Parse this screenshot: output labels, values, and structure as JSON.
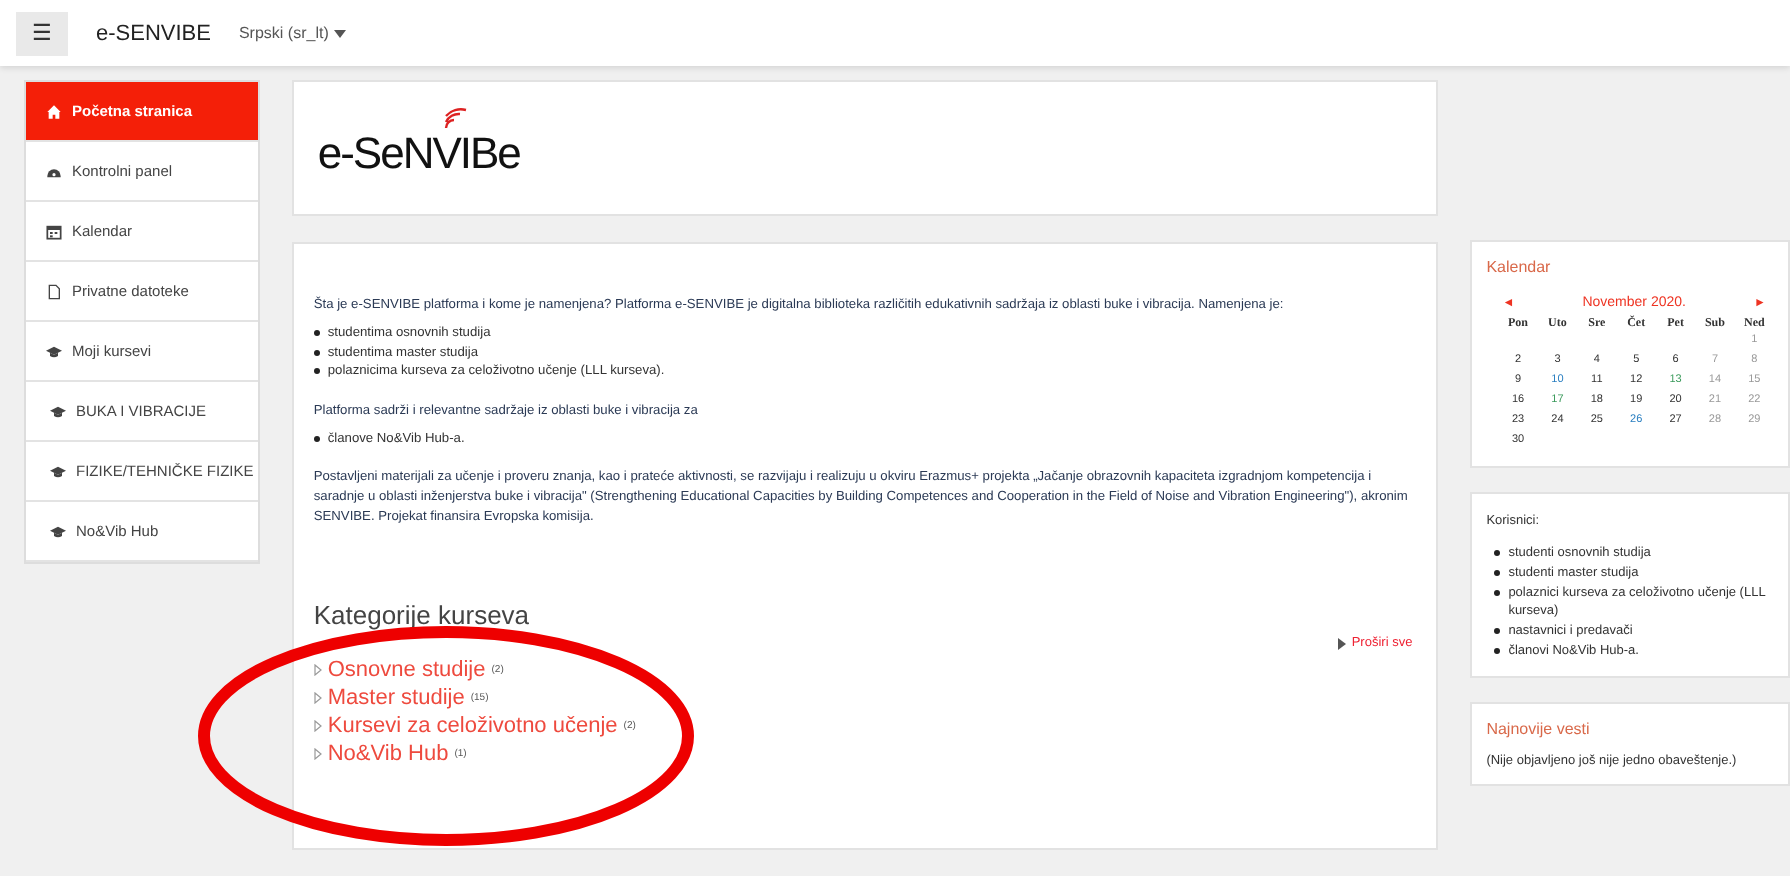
{
  "navbar": {
    "menu_icon": "☰",
    "site_name": "e-SENVIBE",
    "language": "Srpski (sr_lt)"
  },
  "sidebar": {
    "items": [
      {
        "label": "Početna stranica",
        "kind": "home",
        "selected": true
      },
      {
        "label": "Kontrolni panel",
        "kind": "dashboard",
        "selected": false
      },
      {
        "label": "Kalendar",
        "kind": "calendar",
        "selected": false
      },
      {
        "label": "Privatne datoteke",
        "kind": "file",
        "selected": false
      },
      {
        "label": "Moji kursevi",
        "kind": "course",
        "selected": false
      },
      {
        "label": "BUKA I VIBRACIJE",
        "kind": "course",
        "selected": false
      },
      {
        "label": "FIZIKE/TEHNIČKE FIZIKE",
        "kind": "course",
        "selected": false
      },
      {
        "label": "No&Vib Hub",
        "kind": "course",
        "selected": false
      }
    ]
  },
  "logo": {
    "text": "e-SeNVIBe"
  },
  "intro": {
    "paragraphs": [
      {
        "text": "Šta je e-SENVIBE platforma i kome je namenjena? Platforma e-SENVIBE je digitalna biblioteka različitih edukativnih sadržaja iz oblasti buke i vibracija. Namenjena je:",
        "bullets": [
          "studentima osnovnih studija",
          "studentima master studija",
          "polaznicima kurseva za celoživotno učenje (LLL kurseva)."
        ]
      },
      {
        "text": "Platforma sadrži i relevantne sadržaje iz oblasti buke i vibracija za",
        "bullets": [
          "članove No&Vib Hub-a."
        ]
      },
      {
        "text": "Postavljeni materijali za učenje i proveru znanja, kao i prateće aktivnosti, se razvijaju i realizuju u okviru Erazmus+ projekta „Jačanje obrazovnih kapaciteta izgradnjom kompetencija i saradnje u oblasti inženjerstva buke i vibracija\" (Strengthening Educational Capacities by Building Competences and Cooperation in the Field of Noise and Vibration Engineering\"), akronim SENVIBE. Projekat finansira Evropska komisija."
      }
    ]
  },
  "categories": {
    "title": "Kategorije kurseva",
    "expand_all": "Proširi sve",
    "items": [
      {
        "name": "Osnovne studije",
        "count": "(2)"
      },
      {
        "name": "Master studije",
        "count": "(15)"
      },
      {
        "name": "Kursevi za celoživotno učenje",
        "count": "(2)"
      },
      {
        "name": "No&Vib Hub",
        "count": "(1)"
      }
    ]
  },
  "calendar": {
    "title": "Kalendar",
    "prev": "◄",
    "next": "►",
    "month": "November 2020.",
    "weekdays": [
      "Pon",
      "Uto",
      "Sre",
      "Čet",
      "Pet",
      "Sub",
      "Ned"
    ],
    "weeks": [
      [
        {
          "day": "1"
        }
      ],
      [
        {
          "day": "2"
        },
        {
          "day": "3"
        },
        {
          "day": "4"
        },
        {
          "day": "5"
        },
        {
          "day": "6"
        },
        {
          "day": "7"
        },
        {
          "day": "8"
        }
      ],
      [
        {
          "day": "9"
        },
        {
          "day": "10",
          "color": "#2a7fc1"
        },
        {
          "day": "11"
        },
        {
          "day": "12"
        },
        {
          "day": "13",
          "color": "#3a9a5b"
        },
        {
          "day": "14"
        },
        {
          "day": "15"
        }
      ],
      [
        {
          "day": "16"
        },
        {
          "day": "17",
          "color": "#3a9a5b"
        },
        {
          "day": "18"
        },
        {
          "day": "19"
        },
        {
          "day": "20"
        },
        {
          "day": "21"
        },
        {
          "day": "22"
        }
      ],
      [
        {
          "day": "23"
        },
        {
          "day": "24"
        },
        {
          "day": "25"
        },
        {
          "day": "26",
          "color": "#2a7fc1"
        },
        {
          "day": "27"
        },
        {
          "day": "28"
        },
        {
          "day": "29"
        }
      ],
      [
        {
          "day": "30"
        }
      ]
    ]
  },
  "users": {
    "title": "Korisnici:",
    "items": [
      "studenti osnovnih studija",
      "studenti master studija",
      "polaznici kurseva za celoživotno učenje (LLL kurseva)",
      "nastavnici i predavači",
      "članovi No&Vib Hub-a."
    ]
  },
  "news": {
    "title": "Najnovije vesti",
    "text": "(Nije objavljeno još nije jedno obaveštenje.)"
  },
  "annotation": {
    "kind": "ellipse",
    "color": "#ee0000"
  }
}
